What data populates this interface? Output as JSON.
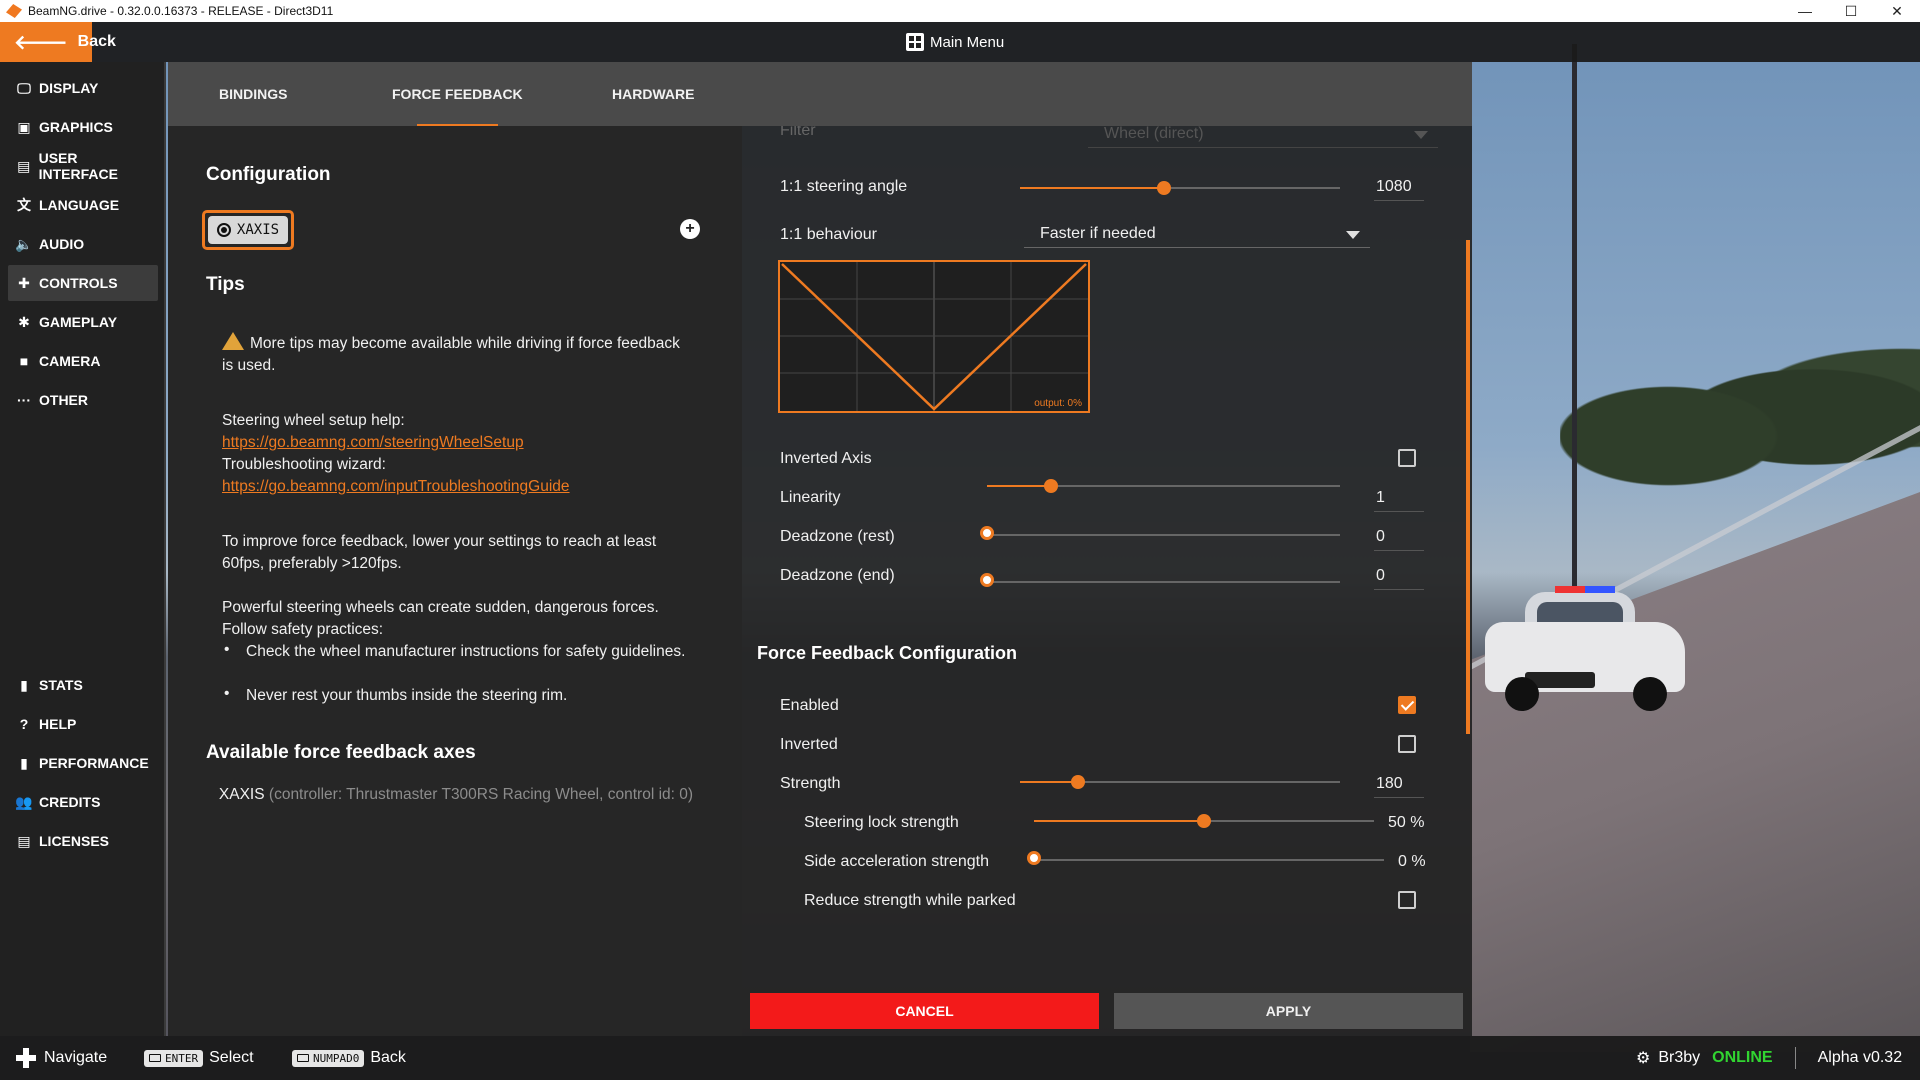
{
  "window": {
    "title": "BeamNG.drive - 0.32.0.0.16373 - RELEASE - Direct3D11",
    "minimize": "—",
    "maximize": "☐",
    "close": "✕"
  },
  "header": {
    "back_label": "Back",
    "title": "Main Menu"
  },
  "sidebar": {
    "items": [
      {
        "label": "DISPLAY",
        "icon": "monitor-icon"
      },
      {
        "label": "GRAPHICS",
        "icon": "image-icon"
      },
      {
        "label": "USER INTERFACE",
        "icon": "ui-icon"
      },
      {
        "label": "LANGUAGE",
        "icon": "translate-icon"
      },
      {
        "label": "AUDIO",
        "icon": "speaker-icon"
      },
      {
        "label": "CONTROLS",
        "icon": "gamepad-icon"
      },
      {
        "label": "GAMEPLAY",
        "icon": "puzzle-icon"
      },
      {
        "label": "CAMERA",
        "icon": "camera-icon"
      },
      {
        "label": "OTHER",
        "icon": "more-icon"
      },
      {
        "label": "STATS",
        "icon": "bar-chart-icon"
      },
      {
        "label": "HELP",
        "icon": "help-icon"
      },
      {
        "label": "PERFORMANCE",
        "icon": "performance-icon"
      },
      {
        "label": "CREDITS",
        "icon": "people-icon"
      },
      {
        "label": "LICENSES",
        "icon": "clipboard-icon"
      }
    ],
    "active": "CONTROLS"
  },
  "tabs": [
    {
      "label": "BINDINGS"
    },
    {
      "label": "FORCE FEEDBACK"
    },
    {
      "label": "HARDWARE"
    }
  ],
  "left": {
    "configuration_title": "Configuration",
    "chip_label": "XAXIS",
    "add_symbol": "+",
    "tips_title": "Tips",
    "tip_warning": "More tips may become available while driving if force feedback is used.",
    "setup_help_label": "Steering wheel setup help:",
    "setup_help_link": "https://go.beamng.com/steeringWheelSetup",
    "troubleshooting_label": "Troubleshooting wizard:",
    "troubleshooting_link": "https://go.beamng.com/inputTroubleshootingGuide",
    "fps_tip": "To improve force feedback, lower your settings to reach at least 60fps, preferably >120fps.",
    "safety_intro": "Powerful steering wheels can create sudden, dangerous forces. Follow safety practices:",
    "safety_bullets": [
      "Check the wheel manufacturer instructions for safety guidelines.",
      "Never rest your thumbs inside the steering rim."
    ],
    "axes_title": "Available force feedback axes",
    "axis_name": "XAXIS",
    "axis_detail": "(controller: Thrustmaster T300RS Racing Wheel, control id: 0)"
  },
  "right": {
    "filter_label": "Filter",
    "filter_value": "Wheel (direct)",
    "steering_angle_label": "1:1 steering angle",
    "steering_angle_value": "1080",
    "steering_angle_fraction": 0.45,
    "behaviour_label": "1:1 behaviour",
    "behaviour_value": "Faster if needed",
    "graph_output": "output: 0%",
    "inverted_axis_label": "Inverted Axis",
    "inverted_axis_checked": false,
    "linearity_label": "Linearity",
    "linearity_value": "1",
    "linearity_fraction": 0.18,
    "deadzone_rest_label": "Deadzone (rest)",
    "deadzone_rest_value": "0",
    "deadzone_end_label": "Deadzone (end)",
    "deadzone_end_value": "0",
    "ffb_title": "Force Feedback Configuration",
    "enabled_label": "Enabled",
    "enabled_checked": true,
    "inverted_label": "Inverted",
    "inverted_checked": false,
    "strength_label": "Strength",
    "strength_value": "180",
    "strength_fraction": 0.18,
    "lock_strength_label": "Steering lock strength",
    "lock_strength_value": "50 %",
    "lock_strength_fraction": 0.5,
    "side_accel_label": "Side acceleration strength",
    "side_accel_value": "0 %",
    "reduce_parked_label": "Reduce strength while parked",
    "reduce_parked_checked": false,
    "cancel_label": "CANCEL",
    "apply_label": "APPLY"
  },
  "bottom": {
    "navigate_label": "Navigate",
    "enter_key": "ENTER",
    "select_label": "Select",
    "numpad_key": "NUMPAD0",
    "back_label": "Back",
    "username": "Br3by",
    "status": "ONLINE",
    "version": "Alpha v0.32"
  },
  "colors": {
    "accent": "#ee7a21",
    "cancel": "#f31a1a",
    "online": "#31d431"
  }
}
